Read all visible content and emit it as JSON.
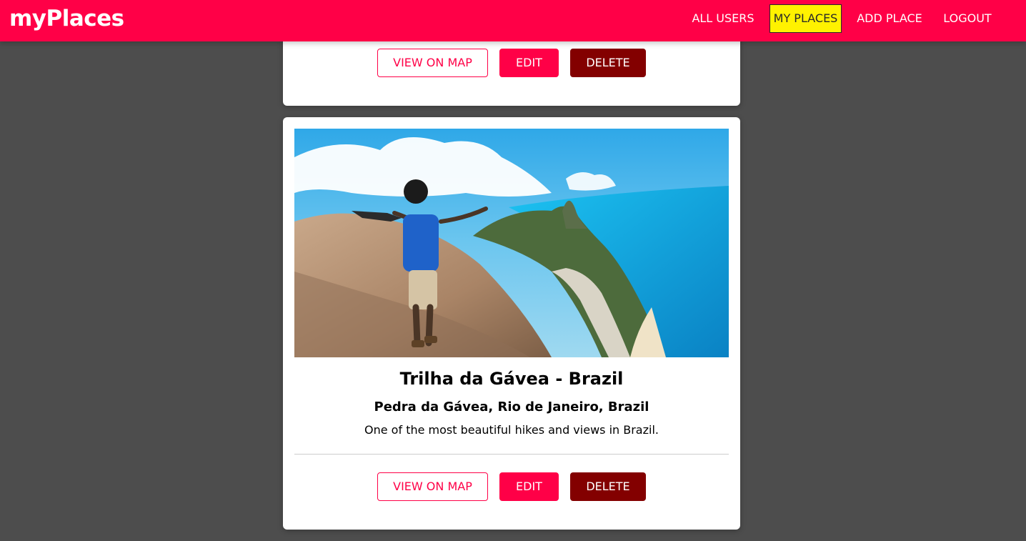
{
  "header": {
    "logo": "myPlaces",
    "nav": [
      {
        "label": "ALL USERS",
        "active": false
      },
      {
        "label": "MY PLACES",
        "active": true
      },
      {
        "label": "ADD PLACE",
        "active": false
      },
      {
        "label": "LOGOUT",
        "active": false
      }
    ]
  },
  "places": [
    {
      "actions": {
        "view_on_map": "VIEW ON MAP",
        "edit": "EDIT",
        "delete": "DELETE"
      }
    },
    {
      "title": "Trilha da Gávea - Brazil",
      "address": "Pedra da Gávea, Rio de Janeiro, Brazil",
      "description": "One of the most beautiful hikes and views in Brazil.",
      "actions": {
        "view_on_map": "VIEW ON MAP",
        "edit": "EDIT",
        "delete": "DELETE"
      }
    }
  ],
  "colors": {
    "brand": "#ff0047",
    "active_nav": "#fff200",
    "danger": "#830000",
    "backdrop": "#4d4d4d"
  }
}
